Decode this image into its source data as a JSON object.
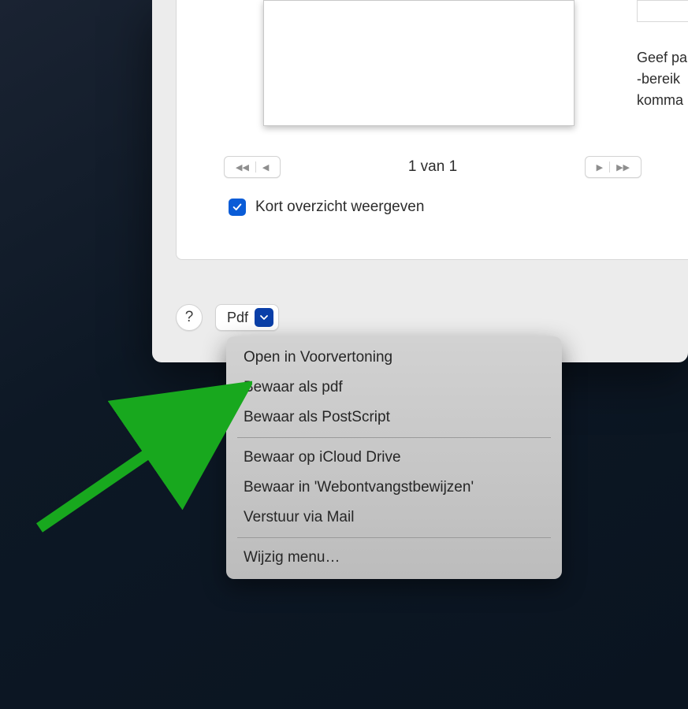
{
  "preview": {
    "page_indicator": "1 van 1",
    "checkbox_label": "Kort overzicht weergeven",
    "checkbox_checked": true,
    "side_text": "Geef pa\n-bereik\nkomma"
  },
  "bottom": {
    "help_label": "?",
    "pdf_label": "Pdf"
  },
  "menu": {
    "items_1": [
      "Open in Voorvertoning",
      "Bewaar als pdf",
      "Bewaar als PostScript"
    ],
    "items_2": [
      "Bewaar op iCloud Drive",
      "Bewaar in 'Webontvangstbewijzen'",
      "Verstuur via Mail"
    ],
    "items_3": [
      "Wijzig menu…"
    ]
  }
}
